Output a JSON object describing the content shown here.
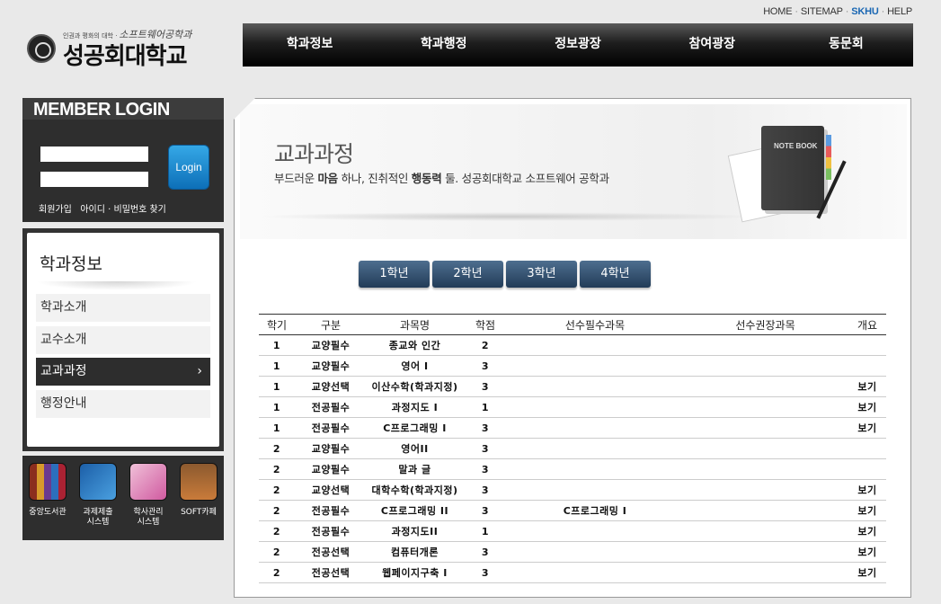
{
  "util_links": {
    "home": "HOME",
    "sitemap": "SITEMAP",
    "skhu": "SKHU",
    "help": "HELP"
  },
  "logo": {
    "tagline": "인권과 평화의 대학 ·",
    "dept": "소프트웨어공학과",
    "name": "성공회대학교"
  },
  "nav": [
    "학과정보",
    "학과행정",
    "정보광장",
    "참여광장",
    "동문회"
  ],
  "login": {
    "title": "MEMBER LOGIN",
    "button": "Login",
    "join": "회원가입",
    "find": "아이디 · 비밀번호 찾기"
  },
  "sidebar": {
    "title": "학과정보",
    "items": [
      "학과소개",
      "교수소개",
      "교과과정",
      "행정안내"
    ],
    "active_index": 2
  },
  "quicklinks": [
    "중앙도서관",
    "과제제출\n시스템",
    "학사관리\n시스템",
    "SOFT카페"
  ],
  "hero": {
    "title": "교과과정",
    "sub_parts": [
      "부드러운 ",
      "마음",
      " 하나, 진취적인 ",
      "행동력",
      " 둘. 성공회대학교 소프트웨어 공학과"
    ],
    "notebook_label": "NOTE BOOK"
  },
  "grade_tabs": [
    "1학년",
    "2학년",
    "3학년",
    "4학년"
  ],
  "table": {
    "headers": [
      "학기",
      "구분",
      "과목명",
      "학점",
      "선수필수과목",
      "선수권장과목",
      "개요"
    ],
    "rows": [
      [
        "1",
        "교양필수",
        "종교와 인간",
        "2",
        "",
        "",
        ""
      ],
      [
        "1",
        "교양필수",
        "영어 I",
        "3",
        "",
        "",
        ""
      ],
      [
        "1",
        "교양선택",
        "이산수학(학과지정)",
        "3",
        "",
        "",
        "보기"
      ],
      [
        "1",
        "전공필수",
        "과정지도 I",
        "1",
        "",
        "",
        "보기"
      ],
      [
        "1",
        "전공필수",
        "C프로그래밍 I",
        "3",
        "",
        "",
        "보기"
      ],
      [
        "2",
        "교양필수",
        "영어II",
        "3",
        "",
        "",
        ""
      ],
      [
        "2",
        "교양필수",
        "말과 글",
        "3",
        "",
        "",
        ""
      ],
      [
        "2",
        "교양선택",
        "대학수학(학과지정)",
        "3",
        "",
        "",
        "보기"
      ],
      [
        "2",
        "전공필수",
        "C프로그래밍 II",
        "3",
        "C프로그래밍 I",
        "",
        "보기"
      ],
      [
        "2",
        "전공필수",
        "과정지도II",
        "1",
        "",
        "",
        "보기"
      ],
      [
        "2",
        "전공선택",
        "컴퓨터개론",
        "3",
        "",
        "",
        "보기"
      ],
      [
        "2",
        "전공선택",
        "웹페이지구축 I",
        "3",
        "",
        "",
        "보기"
      ]
    ]
  }
}
